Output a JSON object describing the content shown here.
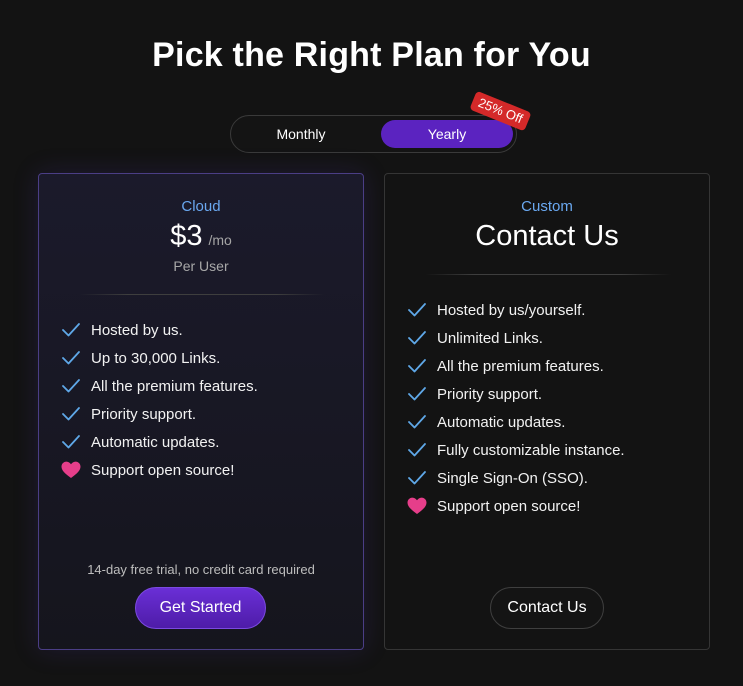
{
  "header": {
    "title": "Pick the Right Plan for You"
  },
  "billing_toggle": {
    "options": [
      "Monthly",
      "Yearly"
    ],
    "selected": "Yearly",
    "badge": "25% Off"
  },
  "colors": {
    "accent": "#5b23c0",
    "plan_name": "#6aa8f0",
    "check": "#5fa8e8",
    "heart": "#e63e8a",
    "badge": "#d42929"
  },
  "plans": [
    {
      "name": "Cloud",
      "price": "$3",
      "price_unit": "/mo",
      "price_note": "Per User",
      "features": [
        {
          "icon": "check-icon",
          "text": "Hosted by us."
        },
        {
          "icon": "check-icon",
          "text": "Up to 30,000 Links."
        },
        {
          "icon": "check-icon",
          "text": "All the premium features."
        },
        {
          "icon": "check-icon",
          "text": "Priority support."
        },
        {
          "icon": "check-icon",
          "text": "Automatic updates."
        },
        {
          "icon": "heart-icon",
          "text": "Support open source!"
        }
      ],
      "note": "14-day free trial, no credit card required",
      "button": "Get Started"
    },
    {
      "name": "Custom",
      "heading": "Contact Us",
      "features": [
        {
          "icon": "check-icon",
          "text": "Hosted by us/yourself."
        },
        {
          "icon": "check-icon",
          "text": "Unlimited Links."
        },
        {
          "icon": "check-icon",
          "text": "All the premium features."
        },
        {
          "icon": "check-icon",
          "text": "Priority support."
        },
        {
          "icon": "check-icon",
          "text": "Automatic updates."
        },
        {
          "icon": "check-icon",
          "text": "Fully customizable instance."
        },
        {
          "icon": "check-icon",
          "text": "Single Sign-On (SSO)."
        },
        {
          "icon": "heart-icon",
          "text": "Support open source!"
        }
      ],
      "button": "Contact Us"
    }
  ]
}
